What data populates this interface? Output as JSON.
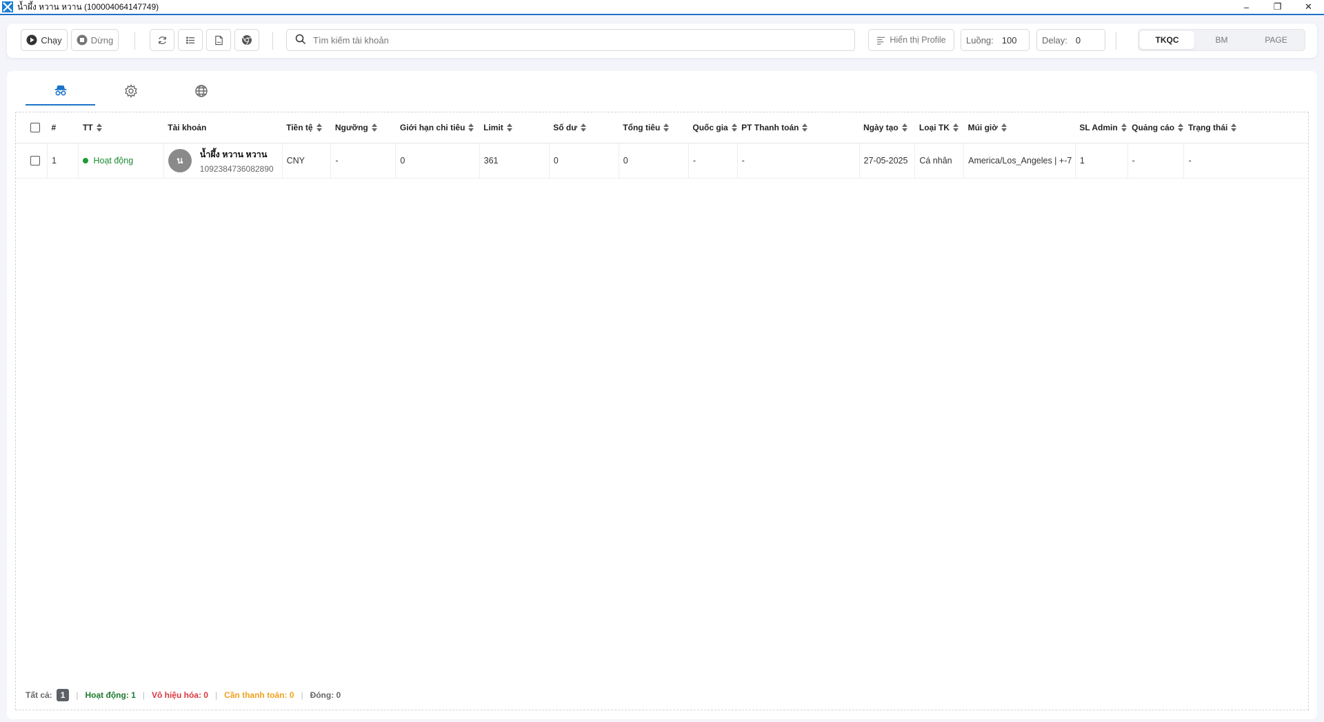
{
  "window": {
    "title": "น้ำผึ้ง หวาน หวาน (100004064147749)",
    "minimize": "–",
    "restore": "❐",
    "close": "✕"
  },
  "toolbar": {
    "run_label": "Chạy",
    "stop_label": "Dừng",
    "search_placeholder": "Tìm kiếm tài khoản",
    "profile_label": "Hiển thị Profile",
    "threads_label": "Luồng:",
    "threads_value": "100",
    "delay_label": "Delay:",
    "delay_value": "0",
    "segments": [
      "TKQC",
      "BM",
      "PAGE"
    ],
    "active_segment": "TKQC"
  },
  "tabs": [
    {
      "icon": "incognito-icon"
    },
    {
      "icon": "gear-icon"
    },
    {
      "icon": "globe-icon"
    }
  ],
  "table": {
    "columns": [
      "#",
      "TT",
      "Tài khoản",
      "Tiền tệ",
      "Ngưỡng",
      "Giới hạn chi tiêu",
      "Limit",
      "Số dư",
      "Tổng tiêu",
      "Quốc gia",
      "PT Thanh toán",
      "Ngày tạo",
      "Loại TK",
      "Múi giờ",
      "SL Admin",
      "Quảng cáo",
      "Trạng thái"
    ],
    "rows": [
      {
        "index": "1",
        "status": "Hoạt động",
        "avatar_letter": "น",
        "account_name": "น้ำผึ้ง หวาน หวาน",
        "account_id": "1092384736082890",
        "currency": "CNY",
        "threshold": "-",
        "spend_limit": "0",
        "limit": "361",
        "balance": "0",
        "total_spend": "0",
        "country": "-",
        "payment": "-",
        "created": "27-05-2025",
        "account_type": "Cá nhân",
        "timezone": "America/Los_Angeles | +-7",
        "admin_count": "1",
        "ads": "-",
        "state": "-"
      }
    ]
  },
  "footer": {
    "all_label": "Tất cả:",
    "all_count": "1",
    "active": "Hoạt động: 1",
    "disabled": "Vô hiệu hóa: 0",
    "need_payment": "Cần thanh toán: 0",
    "closed": "Đóng: 0"
  },
  "colors": {
    "accent": "#1a73c8",
    "active_green": "#1b8a30",
    "disabled_red": "#d9363e",
    "payment_orange": "#f0a020",
    "closed_gray": "#666666"
  }
}
